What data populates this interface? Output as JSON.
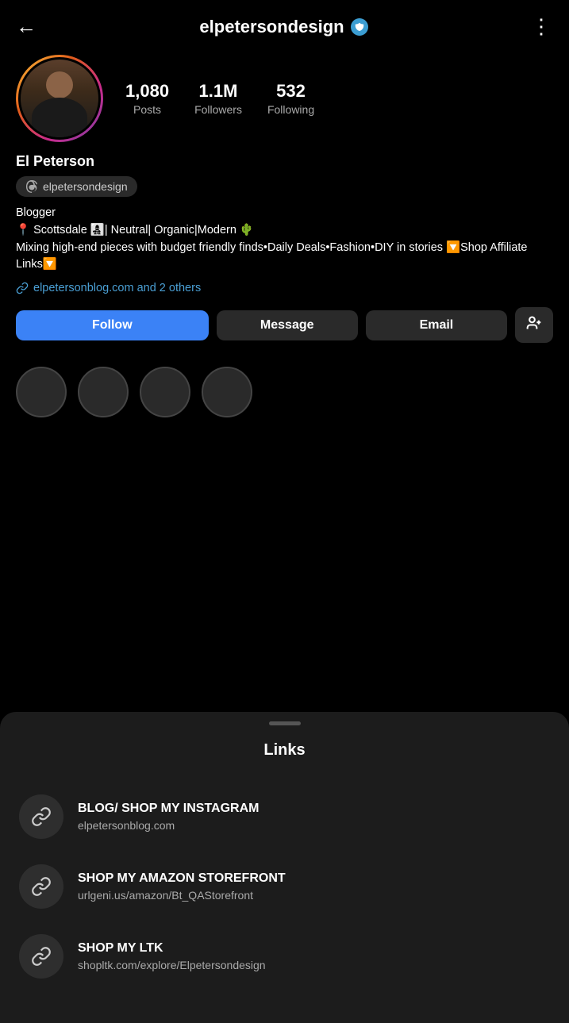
{
  "header": {
    "back_label": "←",
    "username": "elpetersondesign",
    "more_label": "⋮"
  },
  "stats": {
    "posts_count": "1,080",
    "posts_label": "Posts",
    "followers_count": "1.1M",
    "followers_label": "Followers",
    "following_count": "532",
    "following_label": "Following"
  },
  "profile": {
    "name": "El Peterson",
    "threads_handle": "elpetersondesign",
    "bio_line1": "Blogger",
    "bio_line2": "📍 Scottsdale 👩‍👧‍👦| Neutral| Organic|Modern 🌵",
    "bio_line3": "Mixing high-end pieces with budget friendly finds•Daily Deals•Fashion•DIY in stories 🔽Shop Affiliate Links🔽",
    "link_text": "elpetersonblog.com and 2 others"
  },
  "buttons": {
    "follow": "Follow",
    "message": "Message",
    "email": "Email"
  },
  "bottom_sheet": {
    "title": "Links",
    "links": [
      {
        "title": "BLOG/ SHOP MY INSTAGRAM",
        "url": "elpetersonblog.com"
      },
      {
        "title": "SHOP MY AMAZON STOREFRONT",
        "url": "urlgeni.us/amazon/Bt_QAStorefront"
      },
      {
        "title": "SHOP MY LTK",
        "url": "shopltk.com/explore/Elpetersondesign"
      }
    ]
  }
}
